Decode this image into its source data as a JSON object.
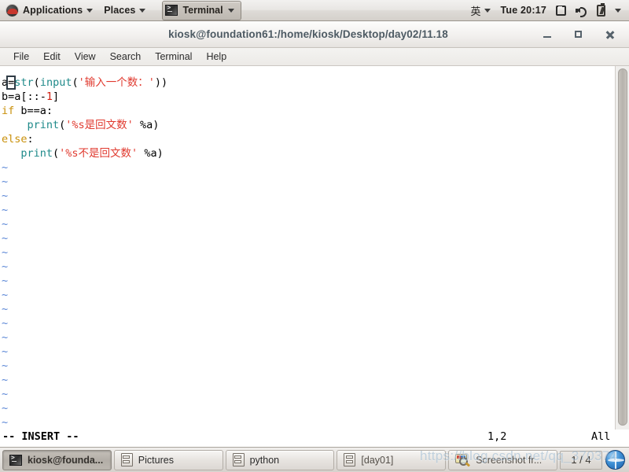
{
  "top_panel": {
    "logo_icon": "redhat-logo-icon",
    "applications_label": "Applications",
    "places_label": "Places",
    "active_window_label": "Terminal",
    "ime_label": "英",
    "clock": "Tue 20:17",
    "display_icon": "display-icon",
    "volume_icon": "speaker-icon",
    "battery_icon": "battery-icon",
    "dropdown_icon": "chevron-down-icon"
  },
  "titlebar": {
    "title": "kiosk@foundation61:/home/kiosk/Desktop/day02/11.18",
    "minimize_icon": "minimize-icon",
    "maximize_icon": "maximize-icon",
    "close_icon": "close-icon"
  },
  "menubar": {
    "items": [
      {
        "label": "File"
      },
      {
        "label": "Edit"
      },
      {
        "label": "View"
      },
      {
        "label": "Search"
      },
      {
        "label": "Terminal"
      },
      {
        "label": "Help"
      }
    ]
  },
  "editor": {
    "lines": [
      {
        "parts": [
          {
            "text": "a",
            "cls": "tok-plain"
          },
          {
            "text": "=",
            "cls": "cursor-blk"
          },
          {
            "text": "str",
            "cls": "tok-fn"
          },
          {
            "text": "(",
            "cls": "tok-plain"
          },
          {
            "text": "input",
            "cls": "tok-fn"
          },
          {
            "text": "(",
            "cls": "tok-plain"
          },
          {
            "text": "'输入一个数：'",
            "cls": "tok-str"
          },
          {
            "text": "))",
            "cls": "tok-plain"
          }
        ]
      },
      {
        "parts": [
          {
            "text": "b=a[::-",
            "cls": "tok-plain"
          },
          {
            "text": "1",
            "cls": "tok-num"
          },
          {
            "text": "]",
            "cls": "tok-plain"
          }
        ]
      },
      {
        "parts": [
          {
            "text": "if",
            "cls": "tok-kw"
          },
          {
            "text": " b==a:",
            "cls": "tok-plain"
          }
        ]
      },
      {
        "parts": [
          {
            "text": "    ",
            "cls": "tok-plain"
          },
          {
            "text": "print",
            "cls": "tok-fn"
          },
          {
            "text": "(",
            "cls": "tok-plain"
          },
          {
            "text": "'%s是回文数'",
            "cls": "tok-str"
          },
          {
            "text": " %a)",
            "cls": "tok-plain"
          }
        ]
      },
      {
        "parts": [
          {
            "text": "else",
            "cls": "tok-kw"
          },
          {
            "text": ":",
            "cls": "tok-plain"
          }
        ]
      },
      {
        "parts": [
          {
            "text": "   ",
            "cls": "tok-plain"
          },
          {
            "text": "print",
            "cls": "tok-fn"
          },
          {
            "text": "(",
            "cls": "tok-plain"
          },
          {
            "text": "'%s不是回文数'",
            "cls": "tok-str"
          },
          {
            "text": " %a)",
            "cls": "tok-plain"
          }
        ]
      }
    ],
    "empty_marker": "~",
    "empty_line_count": 19
  },
  "status_line": {
    "mode": "-- INSERT --",
    "position": "1,2",
    "scroll": "All"
  },
  "taskbar": {
    "buttons": [
      {
        "label": "kiosk@founda...",
        "icon": "terminal-icon",
        "active": true
      },
      {
        "label": "Pictures",
        "icon": "file-manager-icon",
        "active": false
      },
      {
        "label": "python",
        "icon": "file-manager-icon",
        "active": false
      },
      {
        "label": "[day01]",
        "icon": "file-manager-icon",
        "active": false
      },
      {
        "label": "Screenshot fr...",
        "icon": "screenshot-icon",
        "active": false
      }
    ],
    "workspace_label": "1 / 4",
    "globe_icon": "workspace-globe-icon"
  },
  "watermark": {
    "text": "https://blog.csdn.net/qq_370374"
  },
  "colors": {
    "string_red": "#e03a2f",
    "function_teal": "#1f8a8a",
    "keyword_amber": "#c9900a",
    "number_red": "#d01d10",
    "tilde_blue": "#5b87d6",
    "title_text": "#4d5a63",
    "terminal_bg": "#ffffff"
  }
}
